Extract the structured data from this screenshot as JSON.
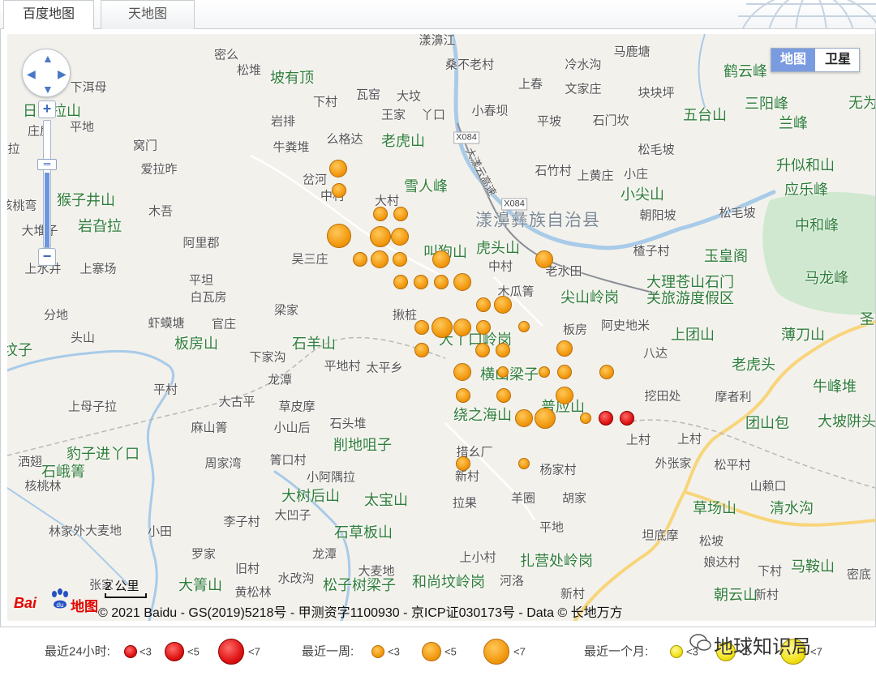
{
  "tabs": [
    {
      "label": "百度地图",
      "active": true
    },
    {
      "label": "天地图",
      "active": false
    }
  ],
  "map_type": {
    "map": "地图",
    "satellite": "卫星",
    "selected": "地图"
  },
  "zoom": {
    "in": "+",
    "out": "−"
  },
  "scale_label": "2 公里",
  "copyright": "© 2021 Baidu - GS(2019)5218号 - 甲测资字1100930 - 京ICP证030173号 - Data © 长地万方",
  "logo": {
    "bai": "Bai",
    "map": "地图"
  },
  "county_label": "漾濞彝族自治县",
  "road_labels": [
    "X084",
    "X084"
  ],
  "expressway_label": "大漾云高速",
  "place_labels_small": [
    "漾濞江",
    "马鹿塘",
    "密么",
    "桑不老村",
    "冷水沟",
    "松堆",
    "上春",
    "文家庄",
    "下洱母",
    "下村",
    "瓦窑",
    "大坟",
    "块块坪",
    "小春坝",
    "岩排",
    "王家",
    "丫口",
    "平坡",
    "石门坎",
    "平地",
    "牛粪堆",
    "么格达",
    "松毛坡",
    "窝门",
    "爱拉昨",
    "石竹村",
    "上黄庄",
    "小庄",
    "岔河",
    "中村",
    "大村",
    "朝阳坡",
    "核桃弯",
    "木吾",
    "松毛坡",
    "大堆子",
    "阿里郡",
    "楂子村",
    "吴三庄",
    "上水井",
    "上寨场",
    "平坦",
    "中村",
    "老水田",
    "白瓦房",
    "木瓜箐",
    "分地",
    "梁家",
    "揪桩",
    "虾蟆塘",
    "官庄",
    "板房",
    "头山",
    "阿史地米",
    "下家沟",
    "龙潭",
    "平地村",
    "太平乡",
    "八达",
    "平村",
    "大古平",
    "草皮摩",
    "挖田处",
    "上母子拉",
    "摩者利",
    "麻山箐",
    "小山后",
    "石头堆",
    "上村",
    "措幺厂",
    "上村",
    "周家湾",
    "箐口村",
    "外张家",
    "松平村",
    "小阿隅拉",
    "新村",
    "杨家村",
    "拉果",
    "羊圈",
    "胡家",
    "山赖口",
    "核桃林",
    "大凹子",
    "李子村",
    "林家",
    "外大麦地",
    "小田",
    "平地",
    "坦底摩",
    "罗家",
    "龙潭",
    "上小村",
    "松坡",
    "娘达村",
    "旧村",
    "大麦地",
    "水改沟",
    "下村",
    "密底",
    "黄松林",
    "河洛",
    "新村",
    "新村",
    "洒翅",
    "庄房",
    "拉",
    "张家"
  ],
  "place_labels_big": [
    "坡有顶",
    "鹤云峰",
    "三阳峰",
    "五台山",
    "兰峰",
    "老虎山",
    "升似和山",
    "雪人峰",
    "应乐峰",
    "小尖山",
    "中和峰",
    "岩旮拉",
    "猴子井山",
    "叫狗山",
    "虎头山",
    "玉皇阁",
    "马龙峰",
    "大理苍山石门关旅游度假区",
    "尖山岭岗",
    "板房山",
    "石羊山",
    "大丫口岭岗",
    "上团山",
    "薄刀山",
    "老虎头",
    "横山梁子",
    "牛峰堆",
    "普应山",
    "绕之海山",
    "团山包",
    "大坡阱头",
    "豹子进丫口",
    "削地咀子",
    "大树后山",
    "太宝山",
    "草场山",
    "清水沟",
    "石草板山",
    "扎营处岭岗",
    "马鞍山",
    "大箐山",
    "松子树梁子",
    "和尚坟岭岗",
    "朝云山",
    "无为",
    "日落拉山",
    "石峨箐",
    "坟子",
    "圣"
  ],
  "quakes": {
    "last_24h": [
      {
        "magnitude_class": "<3"
      },
      {
        "magnitude_class": "<3"
      }
    ],
    "last_week_count": 48
  },
  "legend": {
    "day": {
      "title": "最近24小时:",
      "items": [
        "<3",
        "<5",
        "<7"
      ]
    },
    "week": {
      "title": "最近一周:",
      "items": [
        "<3",
        "<5",
        "<7"
      ]
    },
    "month": {
      "title": "最近一个月:",
      "items": [
        "<3",
        "<5",
        "<7"
      ]
    }
  },
  "watermark": "地球知识局",
  "colors": {
    "last_24h": "#e01414",
    "last_week": "#f29a10",
    "last_month": "#f2e21a",
    "label_green": "#2e7d3a",
    "park_green": "#cfe8cf",
    "river_blue": "#a8cbe8",
    "road_yellow": "#f8d57a"
  }
}
